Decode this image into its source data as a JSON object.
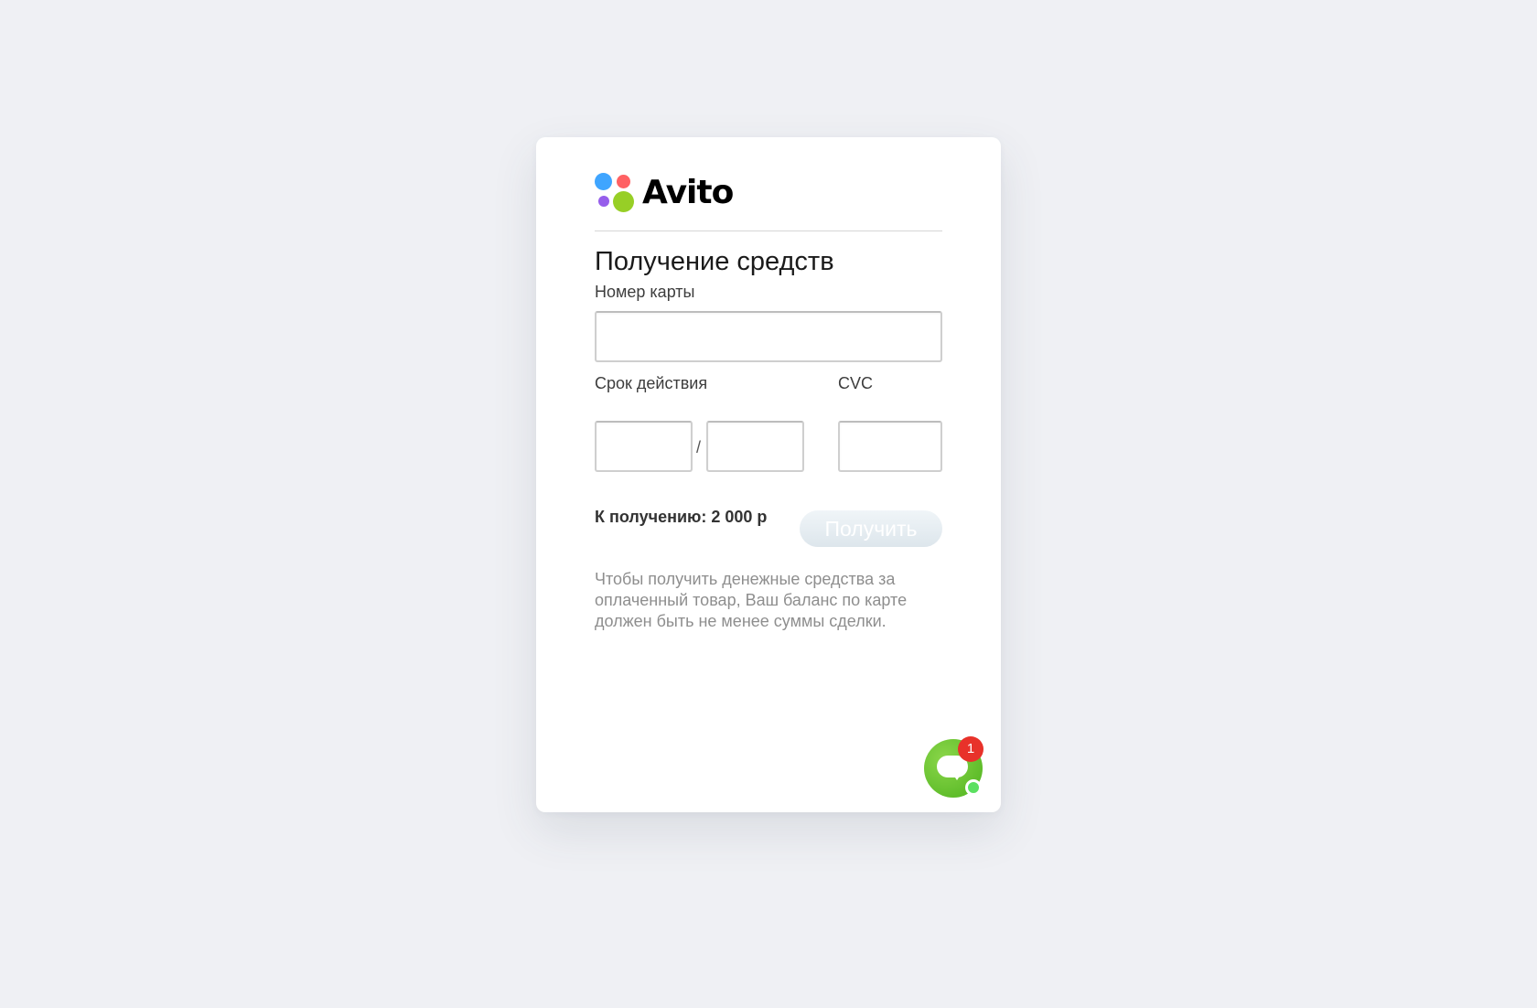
{
  "brand": {
    "name": "Avito",
    "dot_colors": {
      "blue": "#3fa5ff",
      "red": "#ff6163",
      "purple": "#965eeb",
      "green": "#97cf26"
    }
  },
  "form": {
    "title": "Получение средств",
    "card_number": {
      "label": "Номер карты",
      "value": ""
    },
    "expiry": {
      "label": "Срок действия",
      "month_value": "",
      "year_value": "",
      "separator": "/"
    },
    "cvc": {
      "label": "CVC",
      "value": ""
    },
    "amount_text": "К получению: 2 000 р",
    "submit_label": "Получить",
    "note": "Чтобы получить денежные средства за оплаченный товар, Ваш баланс по карте должен быть не менее суммы сделки."
  },
  "chat_widget": {
    "icon": "chat-bubble-icon",
    "unread_count": "1",
    "status": "online",
    "colors": {
      "ring": "#4eb31e",
      "badge": "#e8322a",
      "online": "#5be060"
    }
  },
  "colors": {
    "page_background": "#eff0f4",
    "card_background": "#ffffff",
    "button_disabled": "#dde6ec"
  }
}
